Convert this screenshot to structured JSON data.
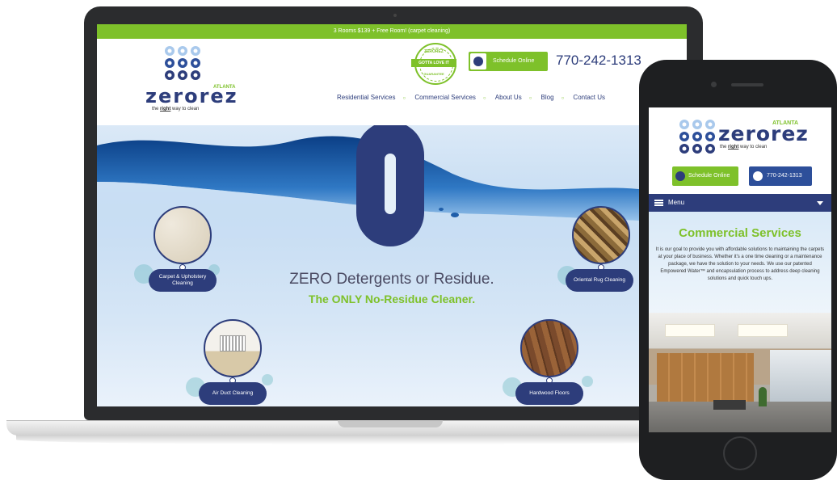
{
  "laptop": {
    "promo_text": "3 Rooms $139 + Free Room! (carpet cleaning)",
    "logo": {
      "word": "zerorez",
      "city": "ATLANTA",
      "tag_prefix": "the",
      "tag_bold": "right",
      "tag_suffix": "way to clean"
    },
    "badge": {
      "top": "ZEROREZ",
      "ribbon": "GOTTA LOVE IT",
      "bottom": "GUARANTEE"
    },
    "schedule_label": "Schedule Online",
    "phone": "770-242-1313",
    "nav": [
      "Residential Services",
      "Commercial Services",
      "About Us",
      "Blog",
      "Contact Us"
    ],
    "hero": {
      "title": "ZERO Detergents or Residue.",
      "subtitle": "The ONLY No-Residue Cleaner."
    },
    "services": {
      "carpet": "Carpet & Upholstery Cleaning",
      "rug": "Oriental Rug Cleaning",
      "duct": "Air Duct Cleaning",
      "wood": "Hardwood Floors"
    }
  },
  "mobile": {
    "logo": {
      "word": "zerorez",
      "city": "ATLANTA",
      "tag_prefix": "the",
      "tag_bold": "right",
      "tag_suffix": "way to clean"
    },
    "schedule_label": "Schedule Online",
    "phone": "770-242-1313",
    "menu_label": "Menu",
    "section_title": "Commercial Services",
    "section_text": "It is our goal to provide you with affordable solutions to maintaining the carpets at your place of business. Whether it's a one time cleaning or a maintenance package, we have the solution to your needs. We use our patented Empowered Water™ and encapsulation process to address deep cleaning solutions and quick touch ups."
  },
  "colors": {
    "brand_navy": "#2d3d7b",
    "brand_green": "#7ec12a",
    "phone_button": "#2d4f9a"
  }
}
